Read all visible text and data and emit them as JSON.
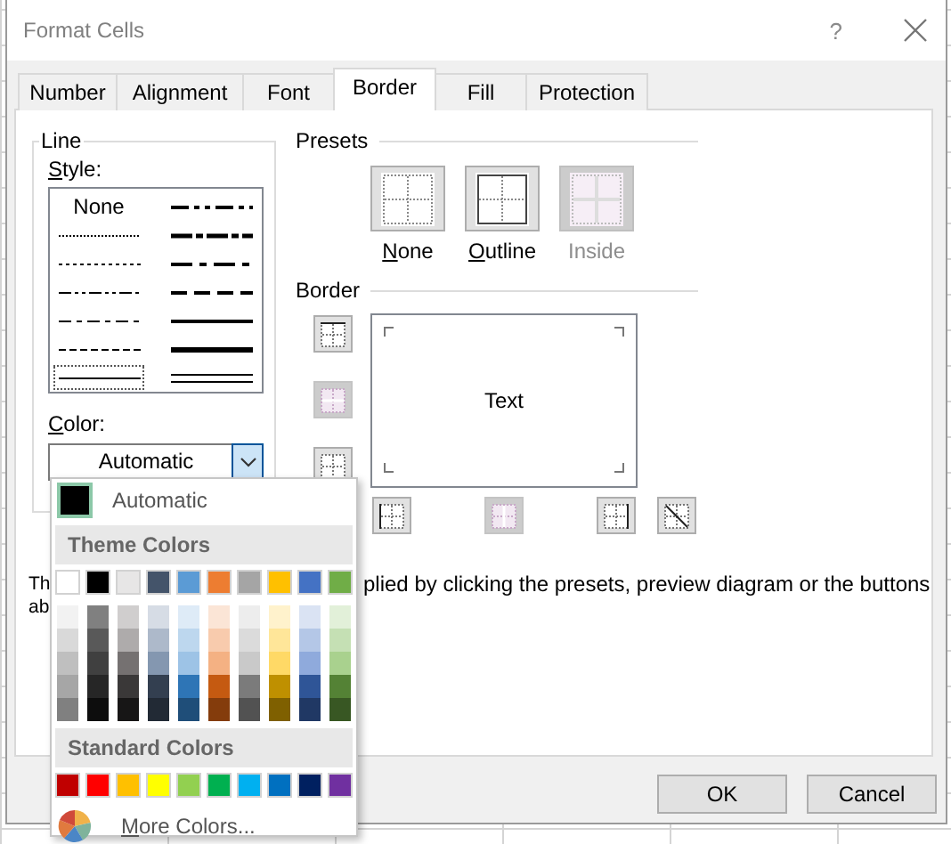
{
  "window": {
    "title": "Format Cells",
    "help": "?"
  },
  "tabs": [
    {
      "label": "Number",
      "selected": false
    },
    {
      "label": "Alignment",
      "selected": false
    },
    {
      "label": "Font",
      "selected": false
    },
    {
      "label": "Border",
      "selected": true
    },
    {
      "label": "Fill",
      "selected": false
    },
    {
      "label": "Protection",
      "selected": false
    }
  ],
  "line": {
    "title": "Line",
    "style_label": "Style:",
    "style_access_key": true,
    "styles": [
      {
        "kind": "none",
        "label": "None",
        "selected": false
      },
      {
        "kind": "hair",
        "selected": false
      },
      {
        "kind": "dotted",
        "selected": false
      },
      {
        "kind": "dash-dot-dot",
        "selected": false
      },
      {
        "kind": "dash-dot",
        "selected": false
      },
      {
        "kind": "dashed",
        "selected": false
      },
      {
        "kind": "thin",
        "selected": true
      },
      {
        "kind": "medium-dash-dot-dot",
        "selected": false
      },
      {
        "kind": "slant-dash-dot",
        "selected": false
      },
      {
        "kind": "medium-dash-dot",
        "selected": false
      },
      {
        "kind": "medium-dashed",
        "selected": false
      },
      {
        "kind": "medium",
        "selected": false
      },
      {
        "kind": "thick",
        "selected": false
      },
      {
        "kind": "double",
        "selected": false
      }
    ],
    "color_label": "Color:",
    "color_access_key": true,
    "color_dropdown": {
      "value": "Automatic",
      "expanded": true
    }
  },
  "presets": {
    "title": "Presets",
    "items": [
      {
        "kind": "none",
        "label": "None",
        "access_key": true,
        "disabled": false
      },
      {
        "kind": "outline",
        "label": "Outline",
        "access_key": true,
        "disabled": false
      },
      {
        "kind": "inside",
        "label": "Inside",
        "access_key": false,
        "disabled": true
      }
    ]
  },
  "border": {
    "title": "Border",
    "preview_text": "Text",
    "side_buttons": [
      {
        "kind": "top",
        "disabled": false
      },
      {
        "kind": "inside-horizontal",
        "disabled": true
      },
      {
        "kind": "bottom",
        "disabled": false
      }
    ],
    "bottom_buttons": [
      {
        "kind": "left",
        "disabled": false
      },
      {
        "kind": "inside-vertical",
        "disabled": true
      },
      {
        "kind": "right",
        "disabled": false
      },
      {
        "kind": "diagonal-down",
        "disabled": false
      }
    ]
  },
  "note": {
    "left_lines": [
      "Th",
      "ab"
    ],
    "right_text": "plied by clicking the presets, preview diagram or the buttons"
  },
  "color_popup": {
    "automatic": "Automatic",
    "theme_title": "Theme Colors",
    "theme_colors": [
      {
        "color": "#ffffff",
        "shades": [
          {
            "color": "#f2f2f2"
          },
          {
            "color": "#d9d9d9"
          },
          {
            "color": "#bfbfbf"
          },
          {
            "color": "#a6a6a6"
          },
          {
            "color": "#808080"
          }
        ]
      },
      {
        "color": "#000000",
        "shades": [
          {
            "color": "#808080"
          },
          {
            "color": "#595959"
          },
          {
            "color": "#404040"
          },
          {
            "color": "#262626"
          },
          {
            "color": "#0d0d0d"
          }
        ]
      },
      {
        "color": "#e7e6e6",
        "shades": [
          {
            "color": "#d0cece"
          },
          {
            "color": "#aeabab"
          },
          {
            "color": "#757171"
          },
          {
            "color": "#3a3838"
          },
          {
            "color": "#171616"
          }
        ]
      },
      {
        "color": "#44546a",
        "shades": [
          {
            "color": "#d6dce5"
          },
          {
            "color": "#adb9ca"
          },
          {
            "color": "#8497b0"
          },
          {
            "color": "#333f50"
          },
          {
            "color": "#222a35"
          }
        ]
      },
      {
        "color": "#5b9bd5",
        "shades": [
          {
            "color": "#deebf7"
          },
          {
            "color": "#bdd7ee"
          },
          {
            "color": "#9dc3e6"
          },
          {
            "color": "#2e75b6"
          },
          {
            "color": "#1f4e79"
          }
        ]
      },
      {
        "color": "#ed7d31",
        "shades": [
          {
            "color": "#fbe5d6"
          },
          {
            "color": "#f8cbad"
          },
          {
            "color": "#f4b183"
          },
          {
            "color": "#c55a11"
          },
          {
            "color": "#843c0c"
          }
        ]
      },
      {
        "color": "#a5a5a5",
        "shades": [
          {
            "color": "#ededed"
          },
          {
            "color": "#dbdbdb"
          },
          {
            "color": "#c9c9c9"
          },
          {
            "color": "#7b7b7b"
          },
          {
            "color": "#525252"
          }
        ]
      },
      {
        "color": "#ffc000",
        "shades": [
          {
            "color": "#fff2cc"
          },
          {
            "color": "#ffe699"
          },
          {
            "color": "#ffd966"
          },
          {
            "color": "#bf9000"
          },
          {
            "color": "#7f6000"
          }
        ]
      },
      {
        "color": "#4472c4",
        "shades": [
          {
            "color": "#dae3f3"
          },
          {
            "color": "#b4c7e7"
          },
          {
            "color": "#8faadc"
          },
          {
            "color": "#2f5597"
          },
          {
            "color": "#203864"
          }
        ]
      },
      {
        "color": "#70ad47",
        "shades": [
          {
            "color": "#e2f0d9"
          },
          {
            "color": "#c5e0b4"
          },
          {
            "color": "#a9d18e"
          },
          {
            "color": "#548235"
          },
          {
            "color": "#385723"
          }
        ]
      }
    ],
    "standard_title": "Standard Colors",
    "standard_colors": [
      {
        "color": "#c00000"
      },
      {
        "color": "#ff0000"
      },
      {
        "color": "#ffc000"
      },
      {
        "color": "#ffff00"
      },
      {
        "color": "#92d050"
      },
      {
        "color": "#00b050"
      },
      {
        "color": "#00b0f0"
      },
      {
        "color": "#0070c0"
      },
      {
        "color": "#002060"
      },
      {
        "color": "#7030a0"
      }
    ],
    "more": "More Colors...",
    "more_access_key": true
  },
  "buttons": [
    {
      "label": "OK"
    },
    {
      "label": "Cancel"
    }
  ]
}
